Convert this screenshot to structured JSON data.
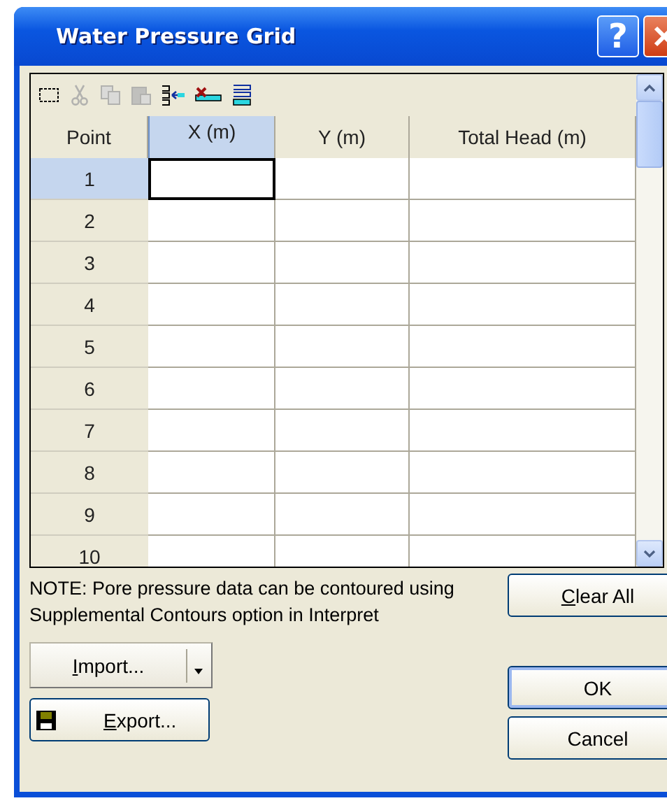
{
  "window": {
    "title": "Water Pressure Grid",
    "title_buttons": [
      {
        "kind": "help",
        "label": "?"
      },
      {
        "kind": "close"
      }
    ]
  },
  "toolbar": [
    {
      "kind": "select",
      "disabled": false
    },
    {
      "kind": "cut",
      "disabled": true
    },
    {
      "kind": "copy",
      "disabled": true
    },
    {
      "kind": "paste",
      "disabled": true
    },
    {
      "kind": "insert",
      "disabled": false
    },
    {
      "kind": "delete",
      "disabled": false
    },
    {
      "kind": "fill",
      "disabled": false
    }
  ],
  "table": {
    "columns": [
      {
        "label": "Point",
        "selected": false
      },
      {
        "label": "X (m)",
        "selected": true
      },
      {
        "label": "Y  (m)",
        "selected": false
      },
      {
        "label": "Total Head (m)",
        "selected": false
      }
    ],
    "rows": [
      {
        "point": "1",
        "selected": true
      },
      {
        "point": "2",
        "selected": false
      },
      {
        "point": "3",
        "selected": false
      },
      {
        "point": "4",
        "selected": false
      },
      {
        "point": "5",
        "selected": false
      },
      {
        "point": "6",
        "selected": false
      },
      {
        "point": "7",
        "selected": false
      },
      {
        "point": "8",
        "selected": false
      },
      {
        "point": "9",
        "selected": false
      },
      {
        "point": "10",
        "selected": false
      }
    ]
  },
  "note": "NOTE: Pore pressure data can be contoured using Supplemental Contours option in Interpret",
  "buttons": {
    "clear_all": {
      "accel": "C",
      "rest": "lear All"
    },
    "import": {
      "accel": "I",
      "rest": "mport..."
    },
    "export": {
      "accel": "E",
      "rest": "xport..."
    },
    "ok": {
      "label": "OK"
    },
    "cancel": {
      "label": "Cancel"
    }
  }
}
